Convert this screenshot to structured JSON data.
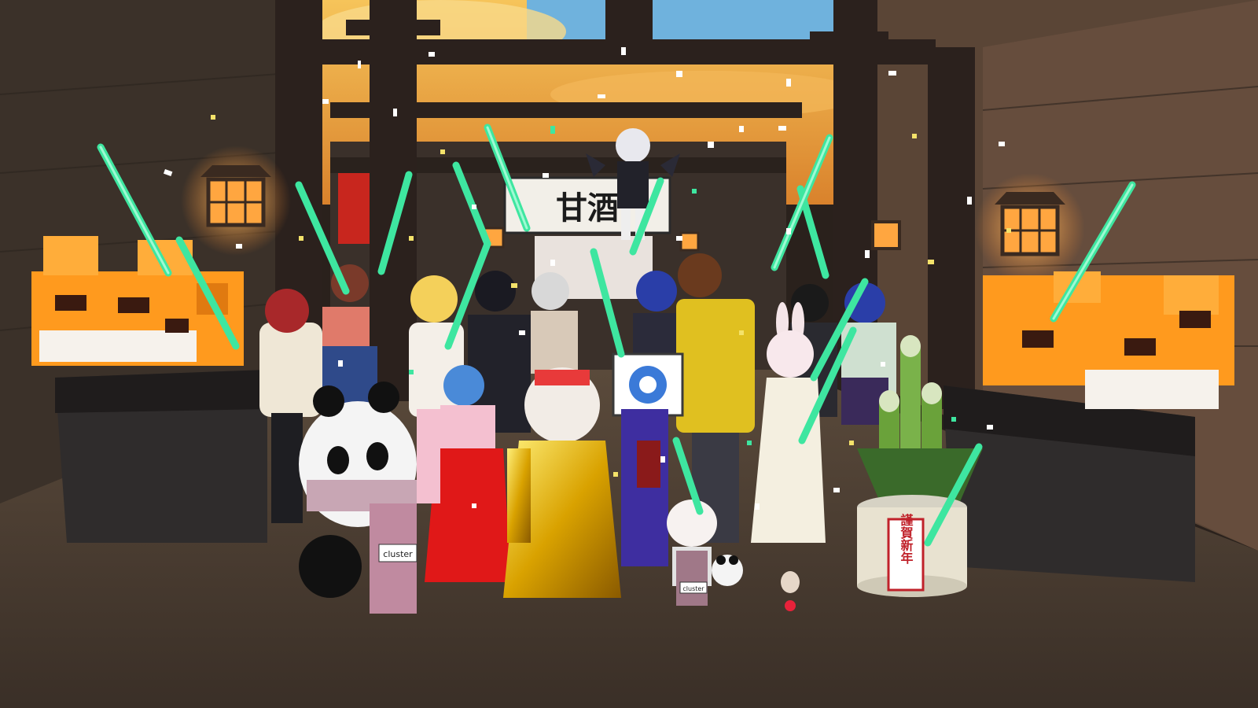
{
  "scene": {
    "shop_sign": "甘酒",
    "kadomatsu_tag": "謹賀新年",
    "scarf_tag_left": "cluster",
    "scarf_tag_right": "cluster"
  },
  "colors": {
    "sky_orange": "#f2b64a",
    "sky_blue": "#5aa6d8",
    "glowstick": "#3ee6a0",
    "tiger_orange": "#ff9a1e",
    "wall": "#3e342e",
    "floor": "#4a3c31"
  },
  "icons": [
    "lantern-icon",
    "glowstick",
    "confetti",
    "tiger-statue",
    "panda-avatar",
    "kadomatsu",
    "cluster-logo-sign"
  ]
}
